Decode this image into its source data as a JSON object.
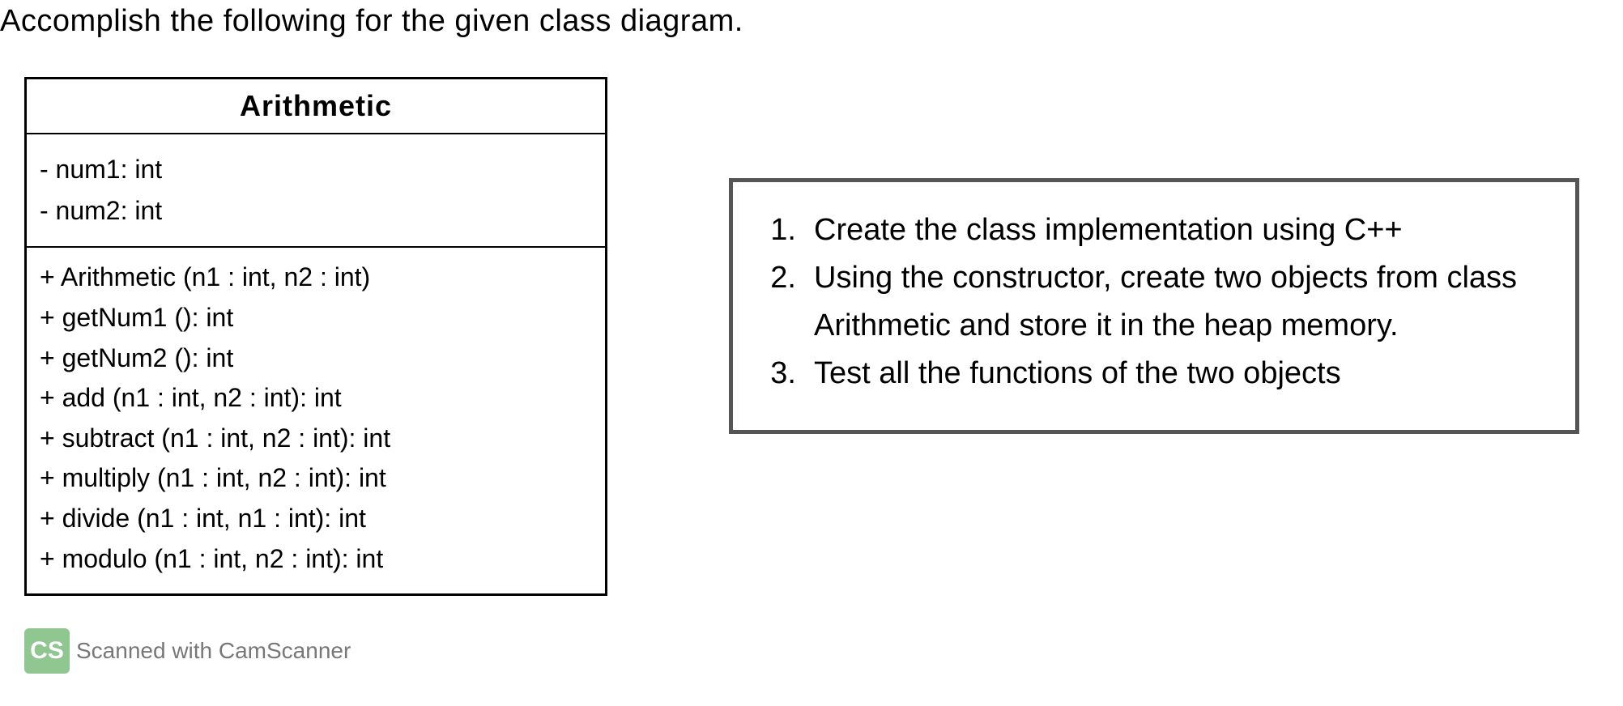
{
  "header": "Accomplish the following for the given class diagram.",
  "uml": {
    "class_name": "Arithmetic",
    "attributes": [
      "- num1: int",
      "- num2: int"
    ],
    "methods": [
      "+ Arithmetic (n1 : int, n2 : int)",
      "+ getNum1 (): int",
      "+ getNum2 (): int",
      "+ add (n1 : int, n2 : int): int",
      "+ subtract (n1 : int, n2 : int): int",
      "+ multiply (n1 : int, n2 : int): int",
      "+ divide (n1 : int, n1 : int): int",
      "+ modulo (n1 : int, n2 : int): int"
    ]
  },
  "tasks": [
    {
      "num": "1.",
      "text": "Create the class implementation using C++"
    },
    {
      "num": "2.",
      "text": "Using the constructor, create two objects from class Arithmetic and store it in the heap memory."
    },
    {
      "num": "3.",
      "text": "Test all the functions of the two objects"
    }
  ],
  "watermark": {
    "logo": "CS",
    "text": "Scanned with CamScanner"
  }
}
